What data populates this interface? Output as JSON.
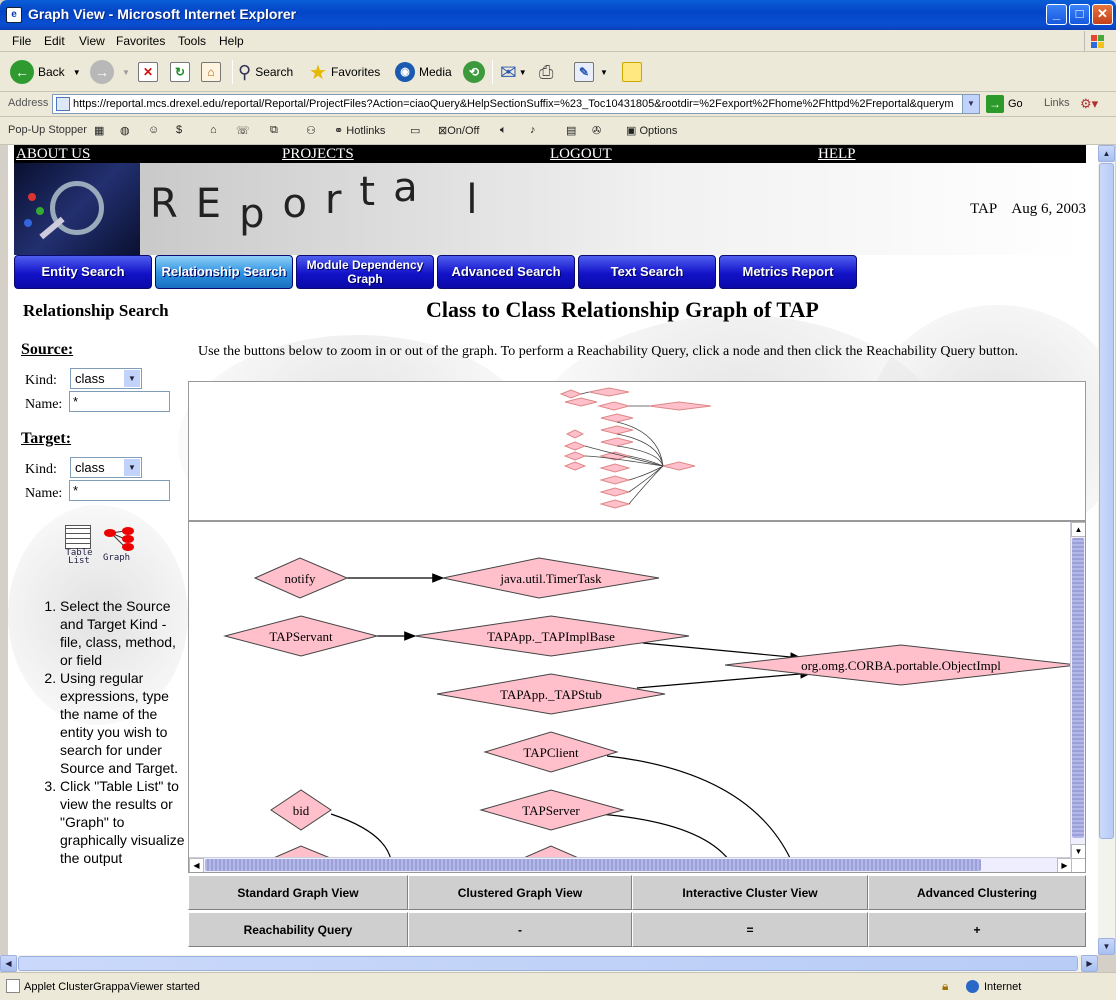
{
  "window": {
    "title": "Graph View - Microsoft Internet Explorer"
  },
  "menu": [
    "File",
    "Edit",
    "View",
    "Favorites",
    "Tools",
    "Help"
  ],
  "toolbar": {
    "back": "Back",
    "search": "Search",
    "favorites": "Favorites",
    "media": "Media"
  },
  "address": {
    "label": "Address",
    "url": "https://reportal.mcs.drexel.edu/reportal/Reportal/ProjectFiles?Action=ciaoQuery&HelpSectionSuffix=%23_Toc10431805&rootdir=%2Fexport%2Fhome%2Fhttpd%2Freportal&querym",
    "go": "Go",
    "links": "Links"
  },
  "popup": {
    "label": "Pop-Up Stopper",
    "hotlinks": "Hotlinks",
    "onoff": "On/Off",
    "options": "Options"
  },
  "topnav": [
    "ABOUT US",
    "PROJECTS",
    "LOGOUT",
    "HELP"
  ],
  "banner": {
    "brand": "REportal",
    "project": "TAP",
    "date": "Aug 6, 2003"
  },
  "navbuttons": [
    "Entity Search",
    "Relationship Search",
    "Module Dependency Graph",
    "Advanced Search",
    "Text Search",
    "Metrics Report"
  ],
  "sidebar": {
    "title": "Relationship Search",
    "source": {
      "heading": "Source:",
      "kind_label": "Kind:",
      "kind_value": "class",
      "name_label": "Name:",
      "name_value": "*"
    },
    "target": {
      "heading": "Target:",
      "kind_label": "Kind:",
      "kind_value": "class",
      "name_label": "Name:",
      "name_value": "*"
    },
    "table_icon_label": [
      "Table",
      "List"
    ],
    "graph_icon_label": "Graph",
    "steps": [
      "Select the Source and Target Kind - file, class, method, or field",
      "Using regular expressions, type the name of the entity you wish to search for under Source and Target.",
      "Click \"Table List\" to view the results or \"Graph\" to graphically visualize the output"
    ]
  },
  "main": {
    "title": "Class to Class Relationship Graph of TAP",
    "hint": "Use the buttons below to zoom in or out of the graph. To perform a Reachability Query, click a node and then click the Reachability Query button."
  },
  "graph": {
    "nodes": [
      "notify",
      "java.util.TimerTask",
      "TAPServant",
      "TAPApp._TAPImplBase",
      "org.omg.CORBA.portable.ObjectImpl",
      "TAPApp._TAPStub",
      "TAPClient",
      "TAPServer",
      "bid"
    ]
  },
  "buttons": {
    "row1": [
      "Standard Graph View",
      "Clustered Graph View",
      "Interactive Cluster View",
      "Advanced Clustering"
    ],
    "row2": [
      "Reachability Query",
      "-",
      "=",
      "+"
    ]
  },
  "status": {
    "message": "Applet ClusterGrappaViewer started",
    "zone": "Internet"
  },
  "colors": {
    "node_fill": "#ffc0cb",
    "nav_button": "#1212c8",
    "nav_active": "#2b90e0"
  }
}
